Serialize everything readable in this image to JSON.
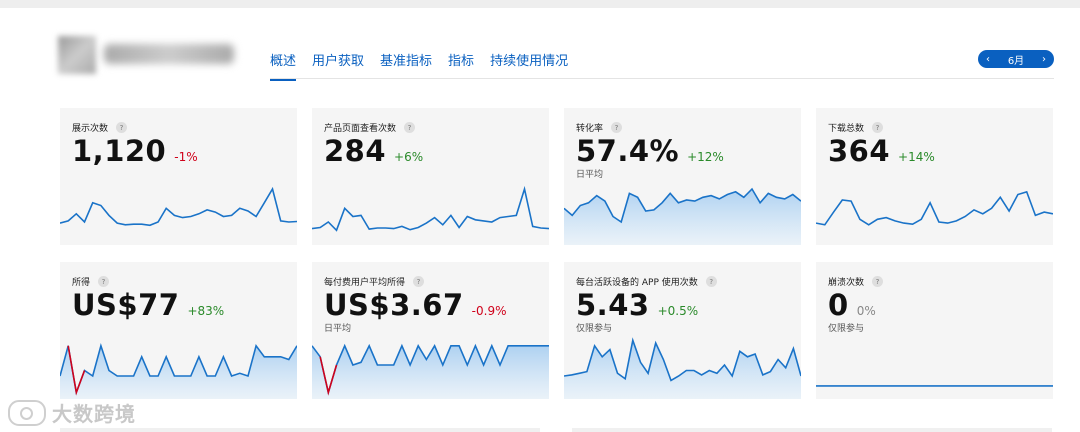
{
  "header": {
    "tabs": [
      {
        "label": "概述",
        "active": true
      },
      {
        "label": "用户获取",
        "active": false
      },
      {
        "label": "基准指标",
        "active": false
      },
      {
        "label": "指标",
        "active": false
      },
      {
        "label": "持续使用情况",
        "active": false
      }
    ],
    "month": {
      "prev": "‹",
      "label": "6月",
      "next": "›"
    }
  },
  "colors": {
    "accent": "#0a60c0",
    "positive": "#2a8a2a",
    "negative": "#d0021b",
    "card_bg": "#f5f5f5"
  },
  "cards": [
    {
      "title": "展示次数",
      "help": "?",
      "value": "1,120",
      "change": "-1%",
      "change_kind": "neg",
      "sub": "",
      "fill": false,
      "spark": [
        0.18,
        0.22,
        0.35,
        0.2,
        0.55,
        0.5,
        0.32,
        0.18,
        0.15,
        0.16,
        0.16,
        0.14,
        0.2,
        0.45,
        0.32,
        0.28,
        0.3,
        0.35,
        0.42,
        0.38,
        0.3,
        0.32,
        0.45,
        0.4,
        0.3,
        0.55,
        0.8,
        0.22,
        0.2,
        0.21
      ]
    },
    {
      "title": "产品页面查看次数",
      "help": "?",
      "value": "284",
      "change": "+6%",
      "change_kind": "pos",
      "sub": "",
      "fill": false,
      "spark": [
        0.08,
        0.1,
        0.2,
        0.05,
        0.45,
        0.3,
        0.32,
        0.07,
        0.09,
        0.09,
        0.08,
        0.12,
        0.06,
        0.1,
        0.18,
        0.28,
        0.15,
        0.32,
        0.1,
        0.3,
        0.24,
        0.22,
        0.2,
        0.28,
        0.3,
        0.32,
        0.8,
        0.12,
        0.09,
        0.08
      ]
    },
    {
      "title": "转化率",
      "help": "?",
      "value": "57.4%",
      "change": "+12%",
      "change_kind": "pos",
      "sub": "日平均",
      "fill": true,
      "spark": [
        0.45,
        0.32,
        0.5,
        0.55,
        0.68,
        0.58,
        0.3,
        0.2,
        0.72,
        0.65,
        0.4,
        0.42,
        0.55,
        0.72,
        0.55,
        0.6,
        0.58,
        0.65,
        0.68,
        0.62,
        0.7,
        0.75,
        0.65,
        0.8,
        0.55,
        0.72,
        0.65,
        0.62,
        0.7,
        0.58
      ]
    },
    {
      "title": "下载总数",
      "help": "?",
      "value": "364",
      "change": "+14%",
      "change_kind": "pos",
      "sub": "",
      "fill": false,
      "spark": [
        0.18,
        0.15,
        0.38,
        0.6,
        0.58,
        0.25,
        0.15,
        0.25,
        0.28,
        0.22,
        0.18,
        0.16,
        0.25,
        0.55,
        0.2,
        0.18,
        0.22,
        0.3,
        0.42,
        0.35,
        0.45,
        0.65,
        0.4,
        0.7,
        0.75,
        0.32,
        0.38,
        0.35
      ]
    },
    {
      "title": "所得",
      "help": "?",
      "value": "US$77",
      "change": "+83%",
      "change_kind": "pos",
      "sub": "",
      "fill": true,
      "spark": [
        0.2,
        0.75,
        -0.1,
        0.3,
        0.2,
        0.75,
        0.3,
        0.2,
        0.2,
        0.2,
        0.55,
        0.2,
        0.2,
        0.55,
        0.2,
        0.2,
        0.2,
        0.55,
        0.2,
        0.2,
        0.55,
        0.2,
        0.25,
        0.2,
        0.75,
        0.55,
        0.55,
        0.55,
        0.5,
        0.75
      ]
    },
    {
      "title": "每付费用户平均所得",
      "help": "?",
      "value": "US$3.67",
      "change": "-0.9%",
      "change_kind": "neg",
      "sub": "日平均",
      "fill": true,
      "spark": [
        0.75,
        0.55,
        -0.1,
        0.4,
        0.75,
        0.4,
        0.45,
        0.75,
        0.4,
        0.4,
        0.4,
        0.75,
        0.4,
        0.75,
        0.5,
        0.75,
        0.4,
        0.75,
        0.75,
        0.4,
        0.75,
        0.4,
        0.75,
        0.4,
        0.75,
        0.75,
        0.75,
        0.75,
        0.75,
        0.75
      ]
    },
    {
      "title": "每台活跃设备的 APP 使用次数",
      "help": "?",
      "value": "5.43",
      "change": "+0.5%",
      "change_kind": "pos",
      "sub": "仅限参与",
      "fill": true,
      "spark": [
        0.2,
        0.22,
        0.25,
        0.28,
        0.75,
        0.55,
        0.68,
        0.25,
        0.15,
        0.85,
        0.45,
        0.25,
        0.8,
        0.5,
        0.12,
        0.2,
        0.3,
        0.3,
        0.22,
        0.3,
        0.25,
        0.4,
        0.2,
        0.65,
        0.55,
        0.6,
        0.22,
        0.28,
        0.5,
        0.35,
        0.7,
        0.2
      ]
    },
    {
      "title": "崩溃次数",
      "help": "?",
      "value": "0",
      "change": "0%",
      "change_kind": "neutral",
      "sub": "仅限参与",
      "fill": false,
      "spark": [
        0.02,
        0.02,
        0.02,
        0.02,
        0.02,
        0.02,
        0.02,
        0.02,
        0.02,
        0.02
      ]
    }
  ],
  "watermark": "大数跨境"
}
